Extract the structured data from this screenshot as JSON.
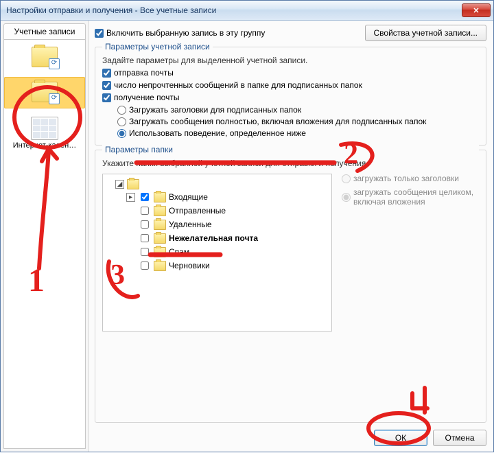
{
  "window": {
    "title": "Настройки отправки и получения - Все учетные записи"
  },
  "left": {
    "tab": "Учетные записи",
    "items": [
      "",
      "",
      "Интернет-кален…"
    ]
  },
  "top": {
    "include_group": "Включить выбранную запись в эту группу",
    "props_button": "Свойства учетной записи..."
  },
  "account_params": {
    "legend": "Параметры учетной записи",
    "desc": "Задайте параметры для выделенной учетной записи.",
    "send": "отправка почты",
    "unread": "число непрочтенных сообщений в папке для подписанных папок",
    "receive": "получение почты",
    "r_headers": "Загружать заголовки для подписанных папок",
    "r_full": "Загружать сообщения полностью, включая вложения для подписанных папок",
    "r_custom": "Использовать поведение, определенное ниже"
  },
  "folder_params": {
    "legend": "Параметры папки",
    "desc": "Укажите папки выбранной учетной записи для отправки и получения",
    "tree": {
      "root": "",
      "nodes": [
        {
          "label": "Входящие",
          "checked": true,
          "bold": false
        },
        {
          "label": "Отправленные",
          "checked": false,
          "bold": false
        },
        {
          "label": "Удаленные",
          "checked": false,
          "bold": false
        },
        {
          "label": "Нежелательная почта",
          "checked": false,
          "bold": true
        },
        {
          "label": "Спам",
          "checked": false,
          "bold": false
        },
        {
          "label": "Черновики",
          "checked": false,
          "bold": false
        }
      ]
    },
    "side": {
      "headers_only": "загружать только заголовки",
      "full_msg": "загружать сообщения целиком, включая вложения"
    }
  },
  "buttons": {
    "ok": "ОК",
    "cancel": "Отмена"
  },
  "annotation_labels": {
    "n1": "1",
    "n2": "2",
    "n3": "3",
    "n4": "4"
  }
}
